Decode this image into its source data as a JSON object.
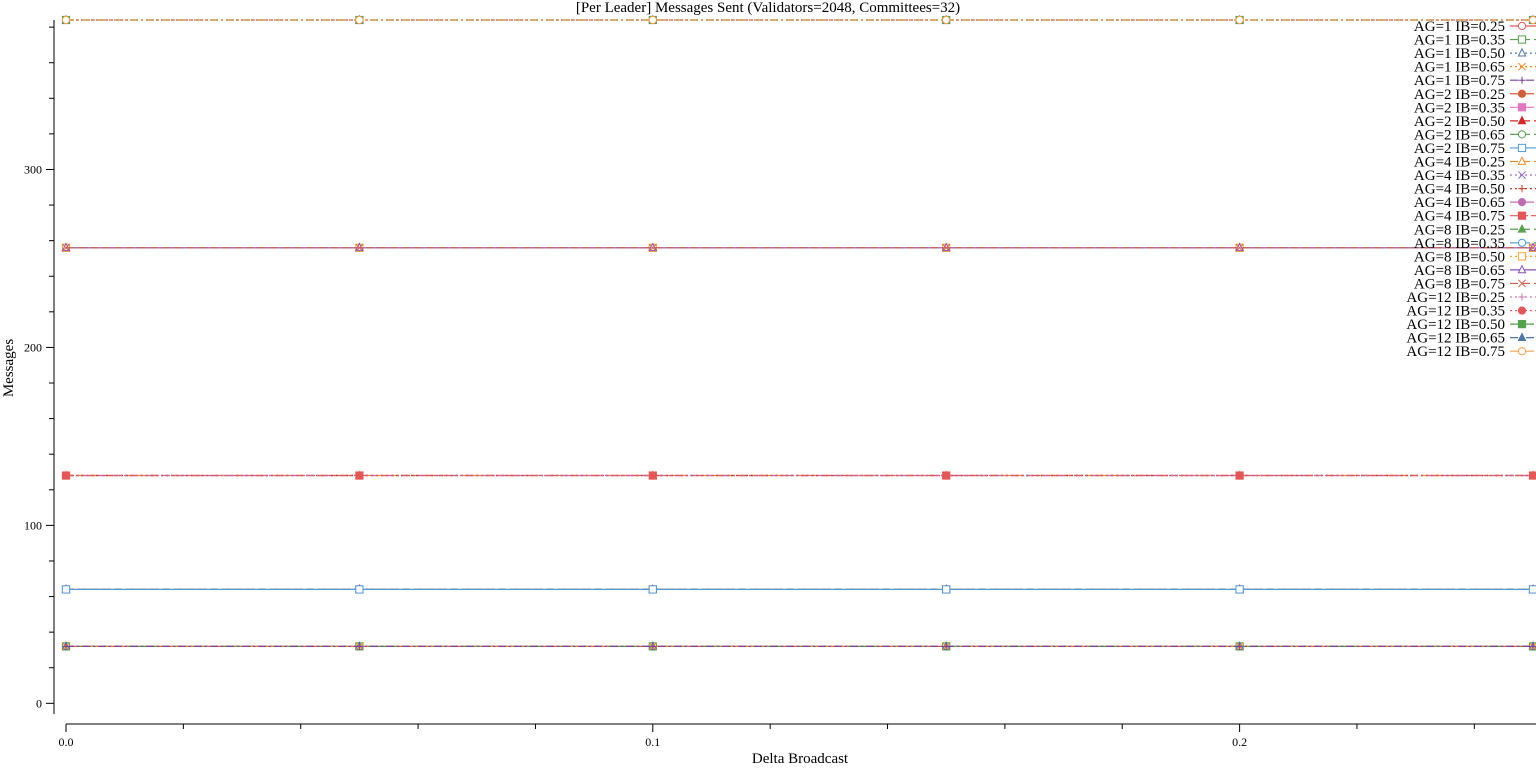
{
  "chart_data": {
    "type": "line",
    "title": "[Per Leader] Messages Sent (Validators=2048, Committees=32)",
    "xlabel": "Delta Broadcast",
    "ylabel": "Messages",
    "xlim": [
      0,
      0.25
    ],
    "ylim": [
      -6,
      384
    ],
    "x_ticks": [
      "0.0",
      "0.1",
      "0.2"
    ],
    "y_ticks": [
      "0",
      "100",
      "200",
      "300"
    ],
    "legend_position": "top-right",
    "grid": false,
    "x": [
      0.0,
      0.05,
      0.1,
      0.15,
      0.2,
      0.25
    ],
    "series": [
      {
        "name": "AG=1 IB=0.25",
        "color": "#e45756",
        "marker": "circle-open",
        "dash": "solid",
        "values": [
          32,
          32,
          32,
          32,
          32,
          32
        ]
      },
      {
        "name": "AG=1 IB=0.35",
        "color": "#54a24b",
        "marker": "square-open",
        "dash": "dashed",
        "values": [
          32,
          32,
          32,
          32,
          32,
          32
        ]
      },
      {
        "name": "AG=1 IB=0.50",
        "color": "#4c78a8",
        "marker": "triangle-open",
        "dash": "dotted",
        "values": [
          32,
          32,
          32,
          32,
          32,
          32
        ]
      },
      {
        "name": "AG=1 IB=0.65",
        "color": "#f58518",
        "marker": "x",
        "dash": "dotted",
        "values": [
          32,
          32,
          32,
          32,
          32,
          32
        ]
      },
      {
        "name": "AG=1 IB=0.75",
        "color": "#7b3f9e",
        "marker": "plus",
        "dash": "dashdot",
        "values": [
          32,
          32,
          32,
          32,
          32,
          32
        ]
      },
      {
        "name": "AG=2 IB=0.25",
        "color": "#d45d3a",
        "marker": "circle",
        "dash": "dashdot",
        "values": [
          64,
          64,
          64,
          64,
          64,
          64
        ]
      },
      {
        "name": "AG=2 IB=0.35",
        "color": "#e377c2",
        "marker": "square",
        "dash": "dashdot",
        "values": [
          64,
          64,
          64,
          64,
          64,
          64
        ]
      },
      {
        "name": "AG=2 IB=0.50",
        "color": "#d62728",
        "marker": "triangle",
        "dash": "dashed",
        "values": [
          64,
          64,
          64,
          64,
          64,
          64
        ]
      },
      {
        "name": "AG=2 IB=0.65",
        "color": "#59a14f",
        "marker": "circle-open",
        "dash": "dashed",
        "values": [
          64,
          64,
          64,
          64,
          64,
          64
        ]
      },
      {
        "name": "AG=2 IB=0.75",
        "color": "#4e9bd6",
        "marker": "square-open",
        "dash": "solid",
        "values": [
          64,
          64,
          64,
          64,
          64,
          64
        ]
      },
      {
        "name": "AG=4 IB=0.25",
        "color": "#f28e2b",
        "marker": "triangle-open",
        "dash": "dashed",
        "values": [
          128,
          128,
          128,
          128,
          128,
          128
        ]
      },
      {
        "name": "AG=4 IB=0.35",
        "color": "#9467bd",
        "marker": "x",
        "dash": "dotted",
        "values": [
          128,
          128,
          128,
          128,
          128,
          128
        ]
      },
      {
        "name": "AG=4 IB=0.50",
        "color": "#c0392b",
        "marker": "plus",
        "dash": "dotted",
        "values": [
          128,
          128,
          128,
          128,
          128,
          128
        ]
      },
      {
        "name": "AG=4 IB=0.65",
        "color": "#c06bb4",
        "marker": "circle",
        "dash": "dashdot",
        "values": [
          128,
          128,
          128,
          128,
          128,
          128
        ]
      },
      {
        "name": "AG=4 IB=0.75",
        "color": "#e45756",
        "marker": "square",
        "dash": "dashdotdot",
        "values": [
          128,
          128,
          128,
          128,
          128,
          128
        ]
      },
      {
        "name": "AG=8 IB=0.25",
        "color": "#54a24b",
        "marker": "triangle",
        "dash": "dashed",
        "values": [
          256,
          256,
          256,
          256,
          256,
          256
        ]
      },
      {
        "name": "AG=8 IB=0.35",
        "color": "#4e9bd6",
        "marker": "circle-open",
        "dash": "dashed",
        "values": [
          256,
          256,
          256,
          256,
          256,
          256
        ]
      },
      {
        "name": "AG=8 IB=0.50",
        "color": "#f5a623",
        "marker": "square-open",
        "dash": "dotted",
        "values": [
          256,
          256,
          256,
          256,
          256,
          256
        ]
      },
      {
        "name": "AG=8 IB=0.65",
        "color": "#8a4fbf",
        "marker": "triangle-open",
        "dash": "solid",
        "values": [
          256,
          256,
          256,
          256,
          256,
          256
        ]
      },
      {
        "name": "AG=8 IB=0.75",
        "color": "#d65f4e",
        "marker": "x",
        "dash": "dashed",
        "values": [
          256,
          256,
          256,
          256,
          256,
          256
        ]
      },
      {
        "name": "AG=12 IB=0.25",
        "color": "#d07fb5",
        "marker": "plus",
        "dash": "dotted",
        "values": [
          384,
          384,
          384,
          384,
          384,
          384
        ]
      },
      {
        "name": "AG=12 IB=0.35",
        "color": "#e45756",
        "marker": "circle",
        "dash": "dotted",
        "values": [
          384,
          384,
          384,
          384,
          384,
          384
        ]
      },
      {
        "name": "AG=12 IB=0.50",
        "color": "#54a24b",
        "marker": "square",
        "dash": "dashdot",
        "values": [
          384,
          384,
          384,
          384,
          384,
          384
        ]
      },
      {
        "name": "AG=12 IB=0.65",
        "color": "#4c78a8",
        "marker": "triangle",
        "dash": "dashdot",
        "values": [
          384,
          384,
          384,
          384,
          384,
          384
        ]
      },
      {
        "name": "AG=12 IB=0.75",
        "color": "#f5a04a",
        "marker": "circle-open",
        "dash": "dashdot",
        "values": [
          384,
          384,
          384,
          384,
          384,
          384
        ]
      }
    ]
  }
}
